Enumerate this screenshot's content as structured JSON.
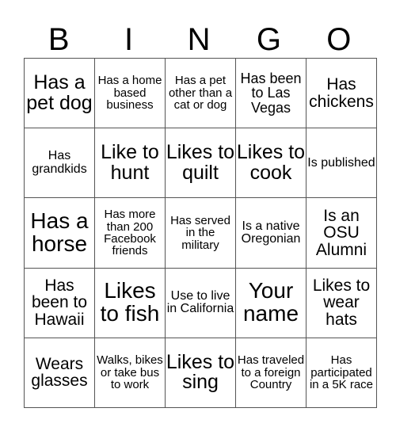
{
  "header": {
    "letters": [
      "B",
      "I",
      "N",
      "G",
      "O"
    ]
  },
  "card": {
    "rows": [
      [
        "Has a pet dog",
        "Has a home based business",
        "Has a pet other than a cat or dog",
        "Has been to Las Vegas",
        "Has chickens"
      ],
      [
        "Has grandkids",
        "Like to hunt",
        "Likes to quilt",
        "Likes to cook",
        "Is published"
      ],
      [
        "Has a horse",
        "Has more than 200 Facebook friends",
        "Has served in the military",
        "Is a native Oregonian",
        "Is an OSU Alumni"
      ],
      [
        "Has been to Hawaii",
        "Likes to fish",
        "Use to live in California",
        "Your name",
        "Likes to wear hats"
      ],
      [
        "Wears glasses",
        "Walks, bikes or take bus to work",
        "Likes to sing",
        "Has traveled to a foreign Country",
        "Has participated in a 5K race"
      ]
    ]
  }
}
